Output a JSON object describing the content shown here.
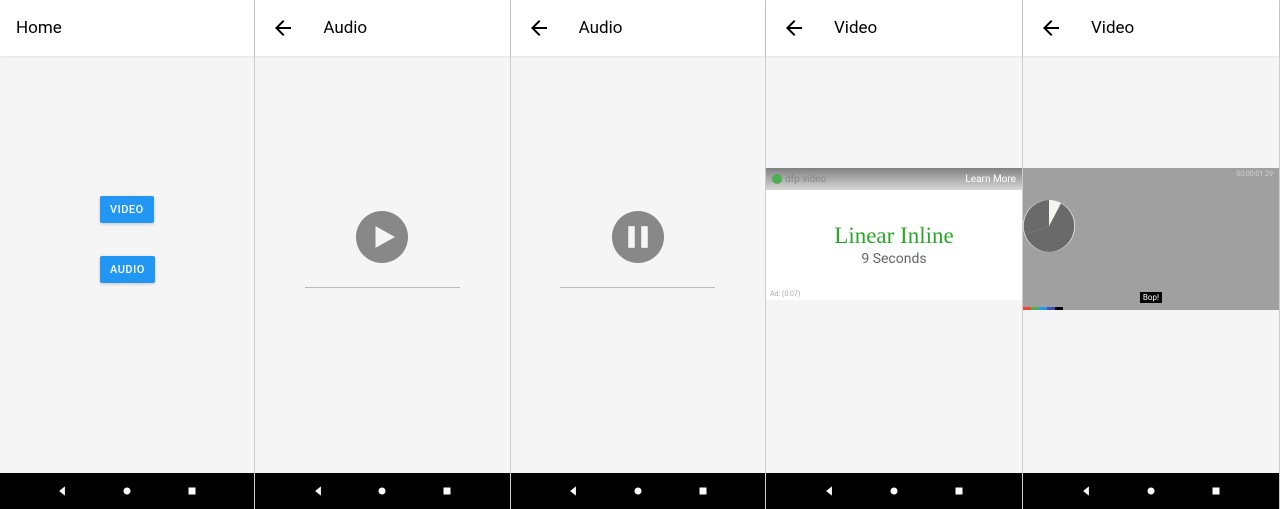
{
  "screens": {
    "home": {
      "title": "Home",
      "buttons": {
        "video": "VIDEO",
        "audio": "AUDIO"
      }
    },
    "audio_play": {
      "title": "Audio"
    },
    "audio_pause": {
      "title": "Audio"
    },
    "video1": {
      "title": "Video",
      "player_badge": "dfp video",
      "learn_more": "Learn More",
      "content_title": "Linear Inline",
      "content_subtitle": "9 Seconds",
      "ad_label": "Ad: (0:07)"
    },
    "video2": {
      "title": "Video",
      "timecode": "00:00:01.29",
      "bop_label": "Bop!"
    }
  }
}
